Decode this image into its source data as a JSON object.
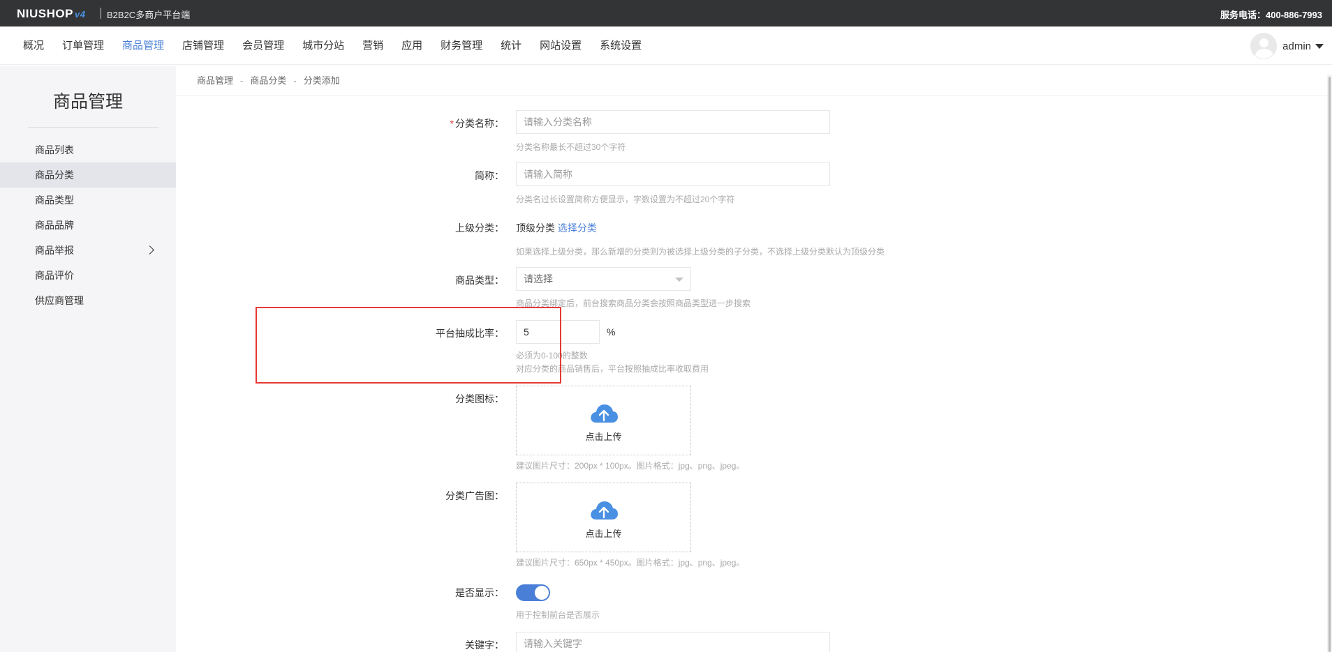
{
  "topbar": {
    "logo": "NIUSHOP",
    "logo_version": "v4",
    "platform": "B2B2C多商户平台端",
    "service": "服务电话：400-886-7993"
  },
  "nav": {
    "items": [
      "概况",
      "订单管理",
      "商品管理",
      "店铺管理",
      "会员管理",
      "城市分站",
      "营销",
      "应用",
      "财务管理",
      "统计",
      "网站设置",
      "系统设置"
    ],
    "active_index": 2,
    "user": "admin"
  },
  "sidebar": {
    "title": "商品管理",
    "items": [
      "商品列表",
      "商品分类",
      "商品类型",
      "商品品牌",
      "商品举报",
      "商品评价",
      "供应商管理"
    ],
    "active_index": 1
  },
  "breadcrumb": [
    "商品管理",
    "商品分类",
    "分类添加"
  ],
  "breadcrumb_sep": "-",
  "form": {
    "name": {
      "required_mark": "*",
      "label": "分类名称：",
      "placeholder": "请输入分类名称",
      "hint": "分类名称最长不超过30个字符"
    },
    "short_name": {
      "label": "简称：",
      "placeholder": "请输入简称",
      "hint": "分类名过长设置简称方便显示，字数设置为不超过20个字符"
    },
    "parent": {
      "label": "上级分类：",
      "value": "顶级分类",
      "link": "选择分类",
      "hint": "如果选择上级分类，那么新增的分类则为被选择上级分类的子分类，不选择上级分类默认为顶级分类"
    },
    "goods_type": {
      "label": "商品类型：",
      "value": "请选择",
      "hint": "商品分类绑定后，前台搜索商品分类会按照商品类型进一步搜索"
    },
    "commission": {
      "label": "平台抽成比率：",
      "value": "5",
      "unit": "%",
      "hint1": "必须为0-100的整数",
      "hint2": "对应分类的商品销售后，平台按照抽成比率收取费用"
    },
    "icon": {
      "label": "分类图标：",
      "upload_text": "点击上传",
      "hint": "建议图片尺寸：200px * 100px。图片格式：jpg、png、jpeg。"
    },
    "ad_image": {
      "label": "分类广告图：",
      "upload_text": "点击上传",
      "hint": "建议图片尺寸：650px * 450px。图片格式：jpg、png、jpeg。"
    },
    "display": {
      "label": "是否显示：",
      "on": true,
      "hint": "用于控制前台是否展示"
    },
    "keywords": {
      "label": "关键字：",
      "placeholder": "请输入关键字"
    }
  },
  "colors": {
    "accent": "#4a7fd8",
    "highlight": "#e53935",
    "topbar": "#333436"
  }
}
